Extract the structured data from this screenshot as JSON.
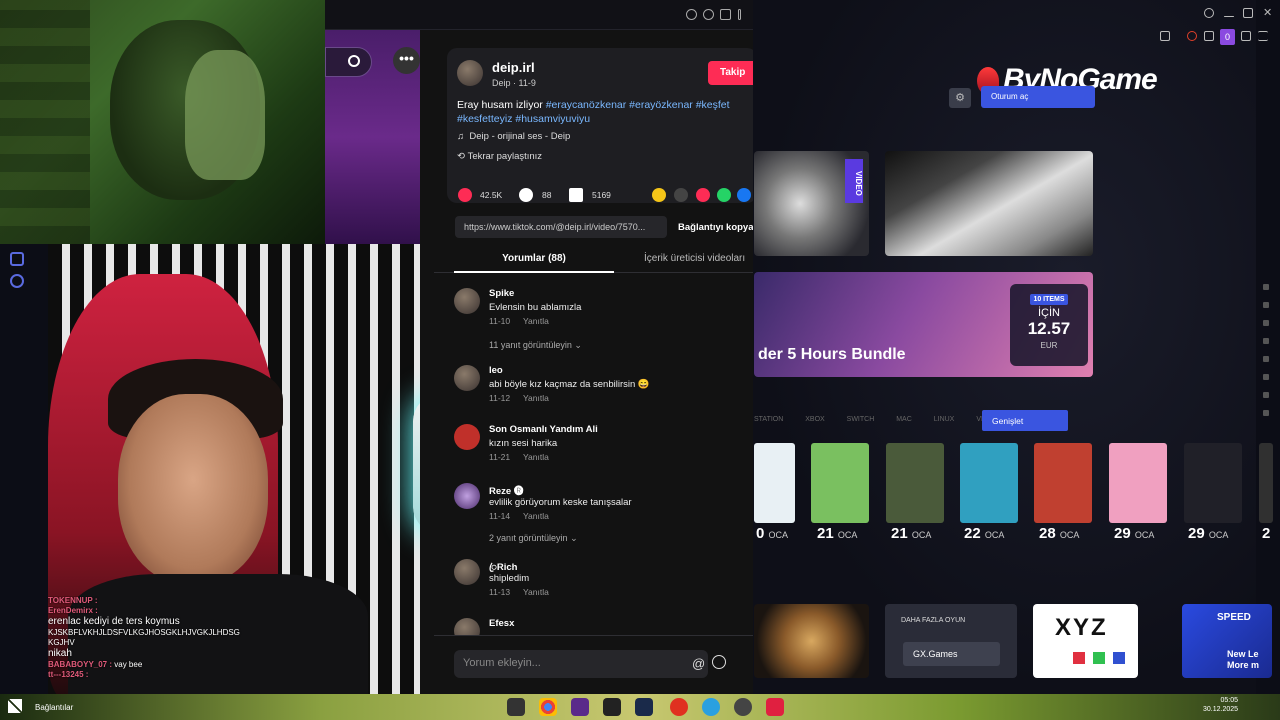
{
  "tiktok": {
    "author": "deip.irl",
    "author_sub": "Deip · 11-9",
    "follow_label": "Takip",
    "description_plain": "Eray husam izliyor",
    "tags_line1": "#eraycanözkenar #erayözkenar #keşfet",
    "tags_line2": "#kesfetteyiz #husamviyuviyu",
    "music": "Deip - orijinal ses - Deip",
    "reposted": "Tekrar paylaştınız",
    "likes": "42.5K",
    "comments_count": "88",
    "saves": "5169",
    "link": "https://www.tiktok.com/@deip.irl/video/7570...",
    "copy_link_label": "Bağlantıyı kopya",
    "tab_comments": "Yorumlar (88)",
    "tab_creator": "İçerik üreticisi videoları",
    "comment_placeholder": "Yorum ekleyin...",
    "comments": [
      {
        "user": "Spike",
        "text": "Evlensin bu ablamızla",
        "date": "11-10",
        "reply": "Yanıtla"
      },
      {
        "user": "leo",
        "text": "abi böyle kız kaçmaz da senbilirsin 😄",
        "date": "11-12",
        "reply": "Yanıtla"
      },
      {
        "user": "Son Osmanlı Yandım Ali",
        "text": "kızın sesi harika",
        "date": "11-21",
        "reply": "Yanıtla"
      },
      {
        "user": "Reze 🅡",
        "text": "evlilik görüyorum keske tanışsalar",
        "date": "11-14",
        "reply": "Yanıtla"
      },
      {
        "user": "ꦿRich",
        "text": "shipledim",
        "date": "11-13",
        "reply": "Yanıtla"
      },
      {
        "user": "Efesx",
        "text": "",
        "date": "",
        "reply": ""
      }
    ],
    "view_replies_1": "11 yanıt görüntüleyin",
    "view_replies_2": "2 yanıt görüntüleyin"
  },
  "chat": {
    "line1_user": "TOKENNUP :",
    "line2_user": "ErenDemirx :",
    "line3": "erenlac kediyi de ters koymus",
    "line4": "KJSKBFLVKHJLDSFVLKGJHOSGKLHJVGKJLHDSG",
    "line5": "KGJHV",
    "line6": "nikah",
    "line7_user": "BABABOYY_07 :",
    "line7_text": "vay bee",
    "line8_user": "tt---13245 :"
  },
  "gx": {
    "logo": "ByNoGame",
    "pill_label": "Oturum aç",
    "video_tag": "VIDEO",
    "bundle_title": "der 5 Hours Bundle",
    "bundle_items": "10 ITEMS",
    "bundle_for": "İÇİN",
    "bundle_price": "12.57",
    "bundle_currency": "EUR",
    "platforms": [
      "STATION",
      "XBOX",
      "SWITCH",
      "MAC",
      "LINUX",
      "VR"
    ],
    "expand_label": "Genişlet",
    "games": [
      {
        "day": "0",
        "month": "OCA",
        "color": "#e8f0f4"
      },
      {
        "day": "21",
        "month": "OCA",
        "color": "#7ac060"
      },
      {
        "day": "21",
        "month": "OCA",
        "color": "#4a5a3a"
      },
      {
        "day": "22",
        "month": "OCA",
        "color": "#30a0c0"
      },
      {
        "day": "28",
        "month": "OCA",
        "color": "#c04030"
      },
      {
        "day": "29",
        "month": "OCA",
        "color": "#f0a0c0"
      },
      {
        "day": "29",
        "month": "OCA",
        "color": "#202028"
      },
      {
        "day": "2",
        "month": "",
        "color": "#303030"
      }
    ],
    "more_games_label": "DAHA FAZLA OYUN",
    "more_games_button": "GX.Games",
    "xyz_label": "XYZ",
    "speed_title": "SPEED",
    "speed_new": "New Le\nMore m",
    "counter": "0"
  },
  "taskbar": {
    "label": "Bağlantılar",
    "time": "05:05",
    "date": "30.12.2025"
  },
  "colors": {
    "tiktok_red": "#fe2c55",
    "gx_blue": "#3a55e0",
    "tag_blue": "#7ab8ff"
  },
  "icons": [
    "search-icon",
    "more-icon",
    "chevron-up-icon",
    "chevron-down-icon",
    "volume-icon",
    "heart-icon",
    "comment-icon",
    "bookmark-icon",
    "music-icon",
    "repost-icon",
    "at-icon",
    "emoji-icon",
    "windows-start-icon"
  ]
}
